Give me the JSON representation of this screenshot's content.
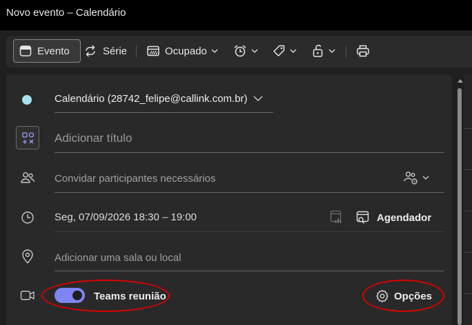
{
  "window": {
    "title": "Novo evento – Calendário"
  },
  "toolbar": {
    "event_label": "Evento",
    "series_label": "Série",
    "status_label": "Ocupado"
  },
  "form": {
    "calendar_label": "Calendário (28742_felipe@callink.com.br)",
    "title_placeholder": "Adicionar título",
    "attendees_placeholder": "Convidar participantes necessários",
    "datetime": "Seg, 07/09/2026 18:30 – 19:00",
    "scheduler_label": "Agendador",
    "location_placeholder": "Adicionar uma sala ou local",
    "teams_label": "Teams reunião",
    "teams_enabled": true,
    "options_label": "Opções"
  },
  "colors": {
    "calendar_dot": "#a6e3ec",
    "toggle_on": "#7f85f5",
    "annotation": "#e00000"
  }
}
